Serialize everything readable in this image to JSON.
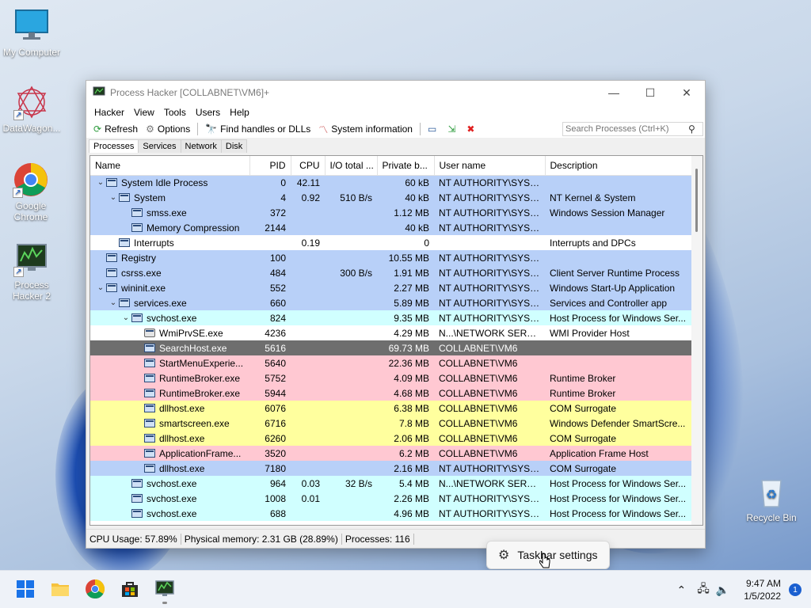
{
  "desktop": {
    "icons": [
      {
        "label": "My Computer",
        "name": "desktop-icon-my-computer"
      },
      {
        "label": "DataWagon...",
        "name": "desktop-icon-datawagon"
      },
      {
        "label": "Google Chrome",
        "name": "desktop-icon-google-chrome"
      },
      {
        "label": "Process Hacker 2",
        "name": "desktop-icon-process-hacker"
      },
      {
        "label": "Recycle Bin",
        "name": "desktop-icon-recycle-bin"
      }
    ]
  },
  "window": {
    "title": "Process Hacker [COLLABNET\\VM6]+",
    "menu": [
      "Hacker",
      "View",
      "Tools",
      "Users",
      "Help"
    ],
    "toolbar": {
      "refresh": "Refresh",
      "options": "Options",
      "find_handles": "Find handles or DLLs",
      "system_info": "System information",
      "search_placeholder": "Search Processes (Ctrl+K)"
    },
    "tabs": [
      "Processes",
      "Services",
      "Network",
      "Disk"
    ],
    "columns": [
      "Name",
      "PID",
      "CPU",
      "I/O total ...",
      "Private b...",
      "User name",
      "Description"
    ],
    "rows": [
      {
        "indent": 0,
        "tw": "⌄",
        "icon": "window",
        "name": "System Idle Process",
        "pid": "0",
        "cpu": "42.11",
        "io": "",
        "priv": "60 kB",
        "user": "NT AUTHORITY\\SYSTEM",
        "desc": "",
        "color": "#b8d0f8"
      },
      {
        "indent": 1,
        "tw": "⌄",
        "icon": "window",
        "name": "System",
        "pid": "4",
        "cpu": "0.92",
        "io": "510 B/s",
        "priv": "40 kB",
        "user": "NT AUTHORITY\\SYSTEM",
        "desc": "NT Kernel & System",
        "color": "#b8d0f8"
      },
      {
        "indent": 2,
        "tw": "",
        "icon": "window",
        "name": "smss.exe",
        "pid": "372",
        "cpu": "",
        "io": "",
        "priv": "1.12 MB",
        "user": "NT AUTHORITY\\SYSTEM",
        "desc": "Windows Session Manager",
        "color": "#b8d0f8"
      },
      {
        "indent": 2,
        "tw": "",
        "icon": "window",
        "name": "Memory Compression",
        "pid": "2144",
        "cpu": "",
        "io": "",
        "priv": "40 kB",
        "user": "NT AUTHORITY\\SYSTEM",
        "desc": "",
        "color": "#b8d0f8"
      },
      {
        "indent": 1,
        "tw": "",
        "icon": "window",
        "name": "Interrupts",
        "pid": "",
        "cpu": "0.19",
        "io": "",
        "priv": "0",
        "user": "",
        "desc": "Interrupts and DPCs",
        "color": "#ffffff"
      },
      {
        "indent": 0,
        "tw": "",
        "icon": "window",
        "name": "Registry",
        "pid": "100",
        "cpu": "",
        "io": "",
        "priv": "10.55 MB",
        "user": "NT AUTHORITY\\SYSTEM",
        "desc": "",
        "color": "#b8d0f8"
      },
      {
        "indent": 0,
        "tw": "",
        "icon": "window",
        "name": "csrss.exe",
        "pid": "484",
        "cpu": "",
        "io": "300 B/s",
        "priv": "1.91 MB",
        "user": "NT AUTHORITY\\SYSTEM",
        "desc": "Client Server Runtime Process",
        "color": "#b8d0f8"
      },
      {
        "indent": 0,
        "tw": "⌄",
        "icon": "window",
        "name": "wininit.exe",
        "pid": "552",
        "cpu": "",
        "io": "",
        "priv": "2.27 MB",
        "user": "NT AUTHORITY\\SYSTEM",
        "desc": "Windows Start-Up Application",
        "color": "#b8d0f8"
      },
      {
        "indent": 1,
        "tw": "⌄",
        "icon": "window",
        "name": "services.exe",
        "pid": "660",
        "cpu": "",
        "io": "",
        "priv": "5.89 MB",
        "user": "NT AUTHORITY\\SYSTEM",
        "desc": "Services and Controller app",
        "color": "#b8d0f8"
      },
      {
        "indent": 2,
        "tw": "⌄",
        "icon": "window",
        "name": "svchost.exe",
        "pid": "824",
        "cpu": "",
        "io": "",
        "priv": "9.35 MB",
        "user": "NT AUTHORITY\\SYSTEM",
        "desc": "Host Process for Windows Ser...",
        "color": "#d0ffff"
      },
      {
        "indent": 3,
        "tw": "",
        "icon": "gear",
        "name": "WmiPrvSE.exe",
        "pid": "4236",
        "cpu": "",
        "io": "",
        "priv": "4.29 MB",
        "user": "N...\\NETWORK SERVICE",
        "desc": "WMI Provider Host",
        "color": "#ffffff"
      },
      {
        "indent": 3,
        "tw": "",
        "icon": "window",
        "name": "SearchHost.exe",
        "pid": "5616",
        "cpu": "",
        "io": "",
        "priv": "69.73 MB",
        "user": "COLLABNET\\VM6",
        "desc": "",
        "color": "#6e6e6e",
        "sel": true
      },
      {
        "indent": 3,
        "tw": "",
        "icon": "window",
        "name": "StartMenuExperie...",
        "pid": "5640",
        "cpu": "",
        "io": "",
        "priv": "22.36 MB",
        "user": "COLLABNET\\VM6",
        "desc": "",
        "color": "#ffc8d2"
      },
      {
        "indent": 3,
        "tw": "",
        "icon": "window",
        "name": "RuntimeBroker.exe",
        "pid": "5752",
        "cpu": "",
        "io": "",
        "priv": "4.09 MB",
        "user": "COLLABNET\\VM6",
        "desc": "Runtime Broker",
        "color": "#ffc8d2"
      },
      {
        "indent": 3,
        "tw": "",
        "icon": "window",
        "name": "RuntimeBroker.exe",
        "pid": "5944",
        "cpu": "",
        "io": "",
        "priv": "4.68 MB",
        "user": "COLLABNET\\VM6",
        "desc": "Runtime Broker",
        "color": "#ffc8d2"
      },
      {
        "indent": 3,
        "tw": "",
        "icon": "window",
        "name": "dllhost.exe",
        "pid": "6076",
        "cpu": "",
        "io": "",
        "priv": "6.38 MB",
        "user": "COLLABNET\\VM6",
        "desc": "COM Surrogate",
        "color": "#ffff9e"
      },
      {
        "indent": 3,
        "tw": "",
        "icon": "window",
        "name": "smartscreen.exe",
        "pid": "6716",
        "cpu": "",
        "io": "",
        "priv": "7.8 MB",
        "user": "COLLABNET\\VM6",
        "desc": "Windows Defender SmartScre...",
        "color": "#ffff9e"
      },
      {
        "indent": 3,
        "tw": "",
        "icon": "window",
        "name": "dllhost.exe",
        "pid": "6260",
        "cpu": "",
        "io": "",
        "priv": "2.06 MB",
        "user": "COLLABNET\\VM6",
        "desc": "COM Surrogate",
        "color": "#ffff9e"
      },
      {
        "indent": 3,
        "tw": "",
        "icon": "window",
        "name": "ApplicationFrame...",
        "pid": "3520",
        "cpu": "",
        "io": "",
        "priv": "6.2 MB",
        "user": "COLLABNET\\VM6",
        "desc": "Application Frame Host",
        "color": "#ffc8d2"
      },
      {
        "indent": 3,
        "tw": "",
        "icon": "window",
        "name": "dllhost.exe",
        "pid": "7180",
        "cpu": "",
        "io": "",
        "priv": "2.16 MB",
        "user": "NT AUTHORITY\\SYSTEM",
        "desc": "COM Surrogate",
        "color": "#b8d0f8"
      },
      {
        "indent": 2,
        "tw": "",
        "icon": "window",
        "name": "svchost.exe",
        "pid": "964",
        "cpu": "0.03",
        "io": "32 B/s",
        "priv": "5.4 MB",
        "user": "N...\\NETWORK SERVICE",
        "desc": "Host Process for Windows Ser...",
        "color": "#d0ffff"
      },
      {
        "indent": 2,
        "tw": "",
        "icon": "window",
        "name": "svchost.exe",
        "pid": "1008",
        "cpu": "0.01",
        "io": "",
        "priv": "2.26 MB",
        "user": "NT AUTHORITY\\SYSTEM",
        "desc": "Host Process for Windows Ser...",
        "color": "#d0ffff"
      },
      {
        "indent": 2,
        "tw": "",
        "icon": "window",
        "name": "svchost.exe",
        "pid": "688",
        "cpu": "",
        "io": "",
        "priv": "4.96 MB",
        "user": "NT AUTHORITY\\SYSTEM",
        "desc": "Host Process for Windows Ser...",
        "color": "#d0ffff"
      }
    ],
    "status": {
      "cpu": "CPU Usage: 57.89%",
      "memory": "Physical memory: 2.31 GB (28.89%)",
      "processes": "Processes: 116"
    }
  },
  "context_menu": {
    "label": "Taskbar settings"
  },
  "taskbar": {
    "time": "9:47 AM",
    "date": "1/5/2022",
    "notification_count": "1"
  }
}
